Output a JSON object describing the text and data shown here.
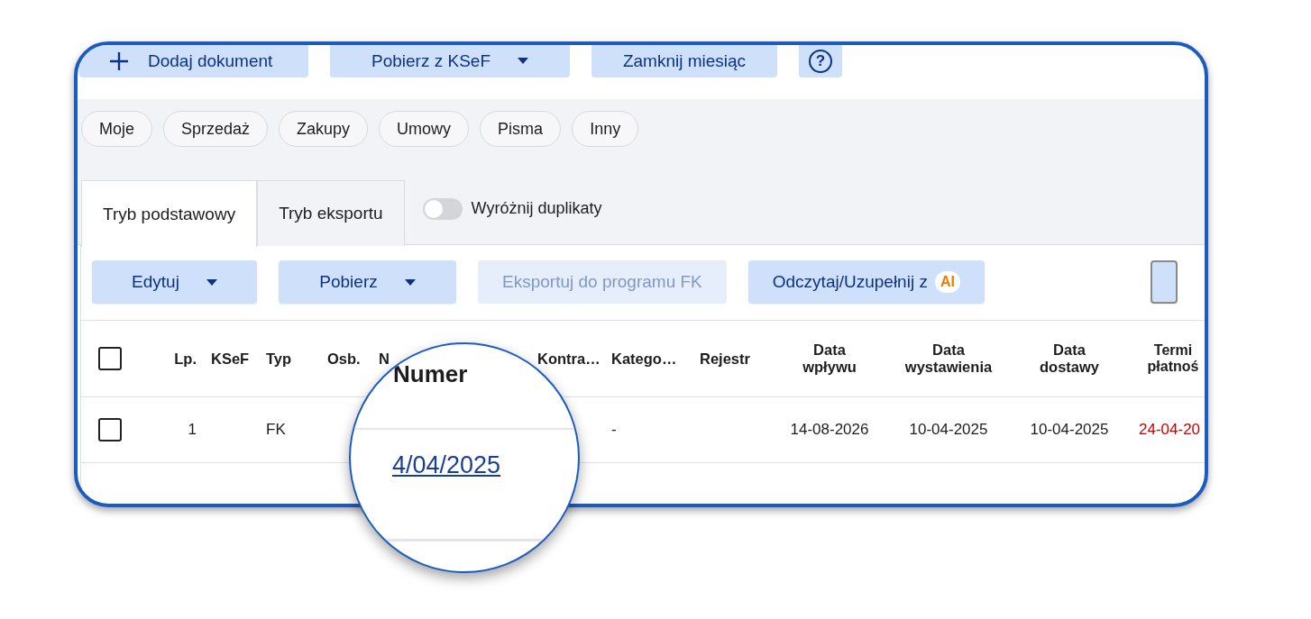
{
  "toolbar": [
    {
      "kind": "add",
      "label": "Dodaj dokument"
    },
    {
      "kind": "dropdown",
      "label": "Pobierz z KSeF"
    },
    {
      "kind": "plain",
      "label": "Zamknij miesiąc"
    },
    {
      "kind": "help",
      "label": "?"
    }
  ],
  "filters": [
    {
      "label": "Moje",
      "selected": false
    },
    {
      "label": "Sprzedaż",
      "selected": false
    },
    {
      "label": "Zakupy",
      "selected": false
    },
    {
      "label": "Umowy",
      "selected": false
    },
    {
      "label": "Pisma",
      "selected": false
    },
    {
      "label": "Inny",
      "selected": false
    }
  ],
  "tabs": [
    {
      "label": "Tryb podstawowy",
      "selected": true
    },
    {
      "label": "Tryb eksportu",
      "selected": false
    }
  ],
  "duplicates_toggle": {
    "label": "Wyróżnij duplikaty",
    "on": false
  },
  "actions": [
    {
      "kind": "dropdown",
      "label": "Edytuj",
      "disabled": false
    },
    {
      "kind": "dropdown",
      "label": "Pobierz",
      "disabled": false
    },
    {
      "kind": "plain",
      "label": "Eksportuj do programu FK",
      "disabled": true
    },
    {
      "kind": "ai",
      "label": "Odczytaj/Uzupełnij z",
      "badge": "AI",
      "disabled": false
    },
    {
      "kind": "partial",
      "disabled": false
    }
  ],
  "table": {
    "select_all": {
      "checked": false
    },
    "columns": [
      {
        "label": "Lp."
      },
      {
        "label": "KSeF"
      },
      {
        "label": "Typ"
      },
      {
        "label": "Osb."
      },
      {
        "label": "N"
      },
      {
        "label": "Kontra…"
      },
      {
        "label": "Katego…"
      },
      {
        "label": "Rejestr"
      },
      {
        "label": "Data wpływu"
      },
      {
        "label": "Data wystawienia"
      },
      {
        "label": "Data dostawy"
      },
      {
        "label": "Termi płatnoś",
        "kind": "due"
      }
    ],
    "rows": [
      {
        "checked": false,
        "overdue": true,
        "cells": [
          "1",
          null,
          "FK",
          null,
          null,
          null,
          "-",
          null,
          "14-08-2026",
          "10-04-2025",
          "10-04-2025",
          "24-04-20"
        ]
      }
    ]
  },
  "magnifier": {
    "heading": "Numer",
    "link": "4/04/2025"
  }
}
